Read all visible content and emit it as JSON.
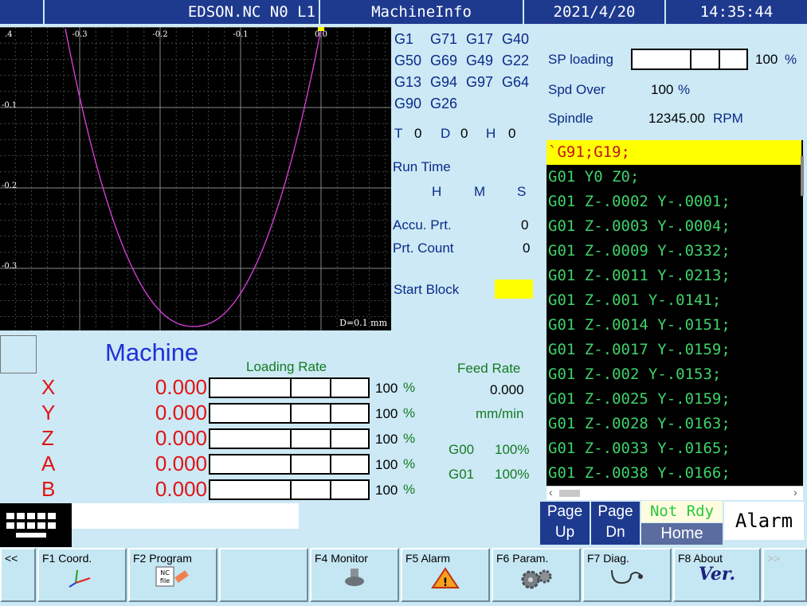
{
  "header": {
    "program": "EDSON.NC N0 L1",
    "screen": "MachineInfo",
    "date": "2021/4/20",
    "time": "14:35:44"
  },
  "plot": {
    "x_ticks": [
      "-0.3",
      "-0.2",
      "-0.1",
      "0.0"
    ],
    "y_ticks": [
      "-0.1",
      "-0.2",
      "-0.3"
    ],
    "left_tick": ".4",
    "scale_note": "D=0.1 mm",
    "curve_color": "#e040e0"
  },
  "gcodes": {
    "row1": [
      "G1",
      "G71",
      "G17",
      "G40"
    ],
    "row2": [
      "G50",
      "G69",
      "G49",
      "G22"
    ],
    "row3": [
      "G13",
      "G94",
      "G97",
      "G64"
    ],
    "row4": [
      "G90",
      "G26"
    ]
  },
  "tools": {
    "t_label": "T",
    "t_val": "0",
    "d_label": "D",
    "d_val": "0",
    "h_label": "H",
    "h_val": "0"
  },
  "runtime": {
    "label": "Run Time",
    "h": "H",
    "m": "M",
    "s": "S"
  },
  "counts": {
    "accu_label": "Accu. Prt.",
    "accu_val": "0",
    "prt_label": "Prt. Count",
    "prt_val": "0",
    "start_label": "Start Block"
  },
  "spindle": {
    "load_label": "SP loading",
    "load_val": "100",
    "load_unit": "%",
    "load_level": 1.0,
    "over_label": "Spd Over",
    "over_val": "100",
    "over_unit": "%",
    "spindle_label": "Spindle",
    "spindle_val": "12345.00",
    "spindle_unit": "RPM"
  },
  "program_lines": [
    "`G91;G19;",
    "G01 Y0 Z0;",
    "G01 Z-.0002 Y-.0001;",
    "G01 Z-.0003 Y-.0004;",
    "G01 Z-.0009 Y-.0332;",
    "G01 Z-.0011 Y-.0213;",
    "G01 Z-.001 Y-.0141;",
    "G01 Z-.0014 Y-.0151;",
    "G01 Z-.0017 Y-.0159;",
    "G01 Z-.002 Y-.0153;",
    "G01 Z-.0025 Y-.0159;",
    "G01 Z-.0028 Y-.0163;",
    "G01 Z-.0033 Y-.0165;",
    "G01 Z-.0038 Y-.0166;"
  ],
  "machine": {
    "title": "Machine",
    "loading_label": "Loading Rate",
    "axes": [
      {
        "name": "X",
        "value": "0.000",
        "load": "100",
        "unit": "%",
        "level": 1.0
      },
      {
        "name": "Y",
        "value": "0.000",
        "load": "100",
        "unit": "%",
        "level": 1.0
      },
      {
        "name": "Z",
        "value": "0.000",
        "load": "100",
        "unit": "%",
        "level": 1.0
      },
      {
        "name": "A",
        "value": "0.000",
        "load": "100",
        "unit": "%",
        "level": 1.0
      },
      {
        "name": "B",
        "value": "0.000",
        "load": "100",
        "unit": "%",
        "level": 1.0
      }
    ]
  },
  "feed": {
    "label": "Feed Rate",
    "value": "0.000",
    "unit": "mm/min",
    "g00_label": "G00",
    "g00_val": "100%",
    "g01_label": "G01",
    "g01_val": "100%"
  },
  "nav": {
    "page_up": [
      "Page",
      "Up"
    ],
    "page_dn": [
      "Page",
      "Dn"
    ],
    "not_rdy": "Not Rdy",
    "home": "Home",
    "alarm": "Alarm"
  },
  "softkeys": {
    "prev": "<<",
    "f1": "F1 Coord.",
    "f2": "F2 Program",
    "f2_icon_text": "NC\nfile",
    "f4": "F4 Monitor",
    "f5": "F5 Alarm",
    "f6": "F6 Param.",
    "f7": "F7 Diag.",
    "f8": "F8 About",
    "f8_icon_text": "Ver.",
    "next": ">>"
  }
}
